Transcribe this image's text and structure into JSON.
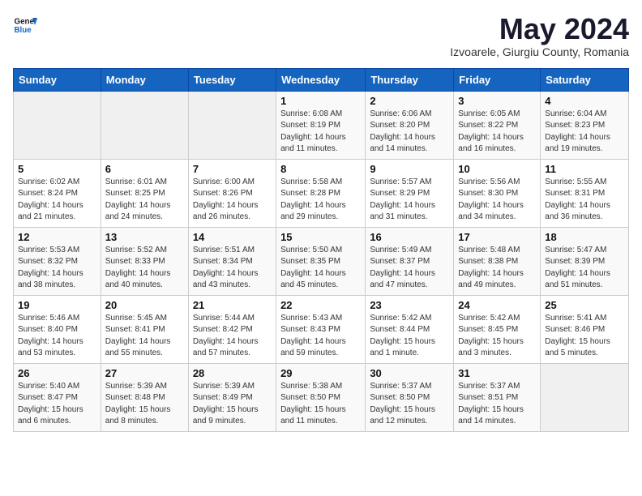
{
  "header": {
    "logo_general": "General",
    "logo_blue": "Blue",
    "month_title": "May 2024",
    "location": "Izvoarele, Giurgiu County, Romania"
  },
  "weekdays": [
    "Sunday",
    "Monday",
    "Tuesday",
    "Wednesday",
    "Thursday",
    "Friday",
    "Saturday"
  ],
  "weeks": [
    [
      {
        "day": "",
        "info": ""
      },
      {
        "day": "",
        "info": ""
      },
      {
        "day": "",
        "info": ""
      },
      {
        "day": "1",
        "info": "Sunrise: 6:08 AM\nSunset: 8:19 PM\nDaylight: 14 hours\nand 11 minutes."
      },
      {
        "day": "2",
        "info": "Sunrise: 6:06 AM\nSunset: 8:20 PM\nDaylight: 14 hours\nand 14 minutes."
      },
      {
        "day": "3",
        "info": "Sunrise: 6:05 AM\nSunset: 8:22 PM\nDaylight: 14 hours\nand 16 minutes."
      },
      {
        "day": "4",
        "info": "Sunrise: 6:04 AM\nSunset: 8:23 PM\nDaylight: 14 hours\nand 19 minutes."
      }
    ],
    [
      {
        "day": "5",
        "info": "Sunrise: 6:02 AM\nSunset: 8:24 PM\nDaylight: 14 hours\nand 21 minutes."
      },
      {
        "day": "6",
        "info": "Sunrise: 6:01 AM\nSunset: 8:25 PM\nDaylight: 14 hours\nand 24 minutes."
      },
      {
        "day": "7",
        "info": "Sunrise: 6:00 AM\nSunset: 8:26 PM\nDaylight: 14 hours\nand 26 minutes."
      },
      {
        "day": "8",
        "info": "Sunrise: 5:58 AM\nSunset: 8:28 PM\nDaylight: 14 hours\nand 29 minutes."
      },
      {
        "day": "9",
        "info": "Sunrise: 5:57 AM\nSunset: 8:29 PM\nDaylight: 14 hours\nand 31 minutes."
      },
      {
        "day": "10",
        "info": "Sunrise: 5:56 AM\nSunset: 8:30 PM\nDaylight: 14 hours\nand 34 minutes."
      },
      {
        "day": "11",
        "info": "Sunrise: 5:55 AM\nSunset: 8:31 PM\nDaylight: 14 hours\nand 36 minutes."
      }
    ],
    [
      {
        "day": "12",
        "info": "Sunrise: 5:53 AM\nSunset: 8:32 PM\nDaylight: 14 hours\nand 38 minutes."
      },
      {
        "day": "13",
        "info": "Sunrise: 5:52 AM\nSunset: 8:33 PM\nDaylight: 14 hours\nand 40 minutes."
      },
      {
        "day": "14",
        "info": "Sunrise: 5:51 AM\nSunset: 8:34 PM\nDaylight: 14 hours\nand 43 minutes."
      },
      {
        "day": "15",
        "info": "Sunrise: 5:50 AM\nSunset: 8:35 PM\nDaylight: 14 hours\nand 45 minutes."
      },
      {
        "day": "16",
        "info": "Sunrise: 5:49 AM\nSunset: 8:37 PM\nDaylight: 14 hours\nand 47 minutes."
      },
      {
        "day": "17",
        "info": "Sunrise: 5:48 AM\nSunset: 8:38 PM\nDaylight: 14 hours\nand 49 minutes."
      },
      {
        "day": "18",
        "info": "Sunrise: 5:47 AM\nSunset: 8:39 PM\nDaylight: 14 hours\nand 51 minutes."
      }
    ],
    [
      {
        "day": "19",
        "info": "Sunrise: 5:46 AM\nSunset: 8:40 PM\nDaylight: 14 hours\nand 53 minutes."
      },
      {
        "day": "20",
        "info": "Sunrise: 5:45 AM\nSunset: 8:41 PM\nDaylight: 14 hours\nand 55 minutes."
      },
      {
        "day": "21",
        "info": "Sunrise: 5:44 AM\nSunset: 8:42 PM\nDaylight: 14 hours\nand 57 minutes."
      },
      {
        "day": "22",
        "info": "Sunrise: 5:43 AM\nSunset: 8:43 PM\nDaylight: 14 hours\nand 59 minutes."
      },
      {
        "day": "23",
        "info": "Sunrise: 5:42 AM\nSunset: 8:44 PM\nDaylight: 15 hours\nand 1 minute."
      },
      {
        "day": "24",
        "info": "Sunrise: 5:42 AM\nSunset: 8:45 PM\nDaylight: 15 hours\nand 3 minutes."
      },
      {
        "day": "25",
        "info": "Sunrise: 5:41 AM\nSunset: 8:46 PM\nDaylight: 15 hours\nand 5 minutes."
      }
    ],
    [
      {
        "day": "26",
        "info": "Sunrise: 5:40 AM\nSunset: 8:47 PM\nDaylight: 15 hours\nand 6 minutes."
      },
      {
        "day": "27",
        "info": "Sunrise: 5:39 AM\nSunset: 8:48 PM\nDaylight: 15 hours\nand 8 minutes."
      },
      {
        "day": "28",
        "info": "Sunrise: 5:39 AM\nSunset: 8:49 PM\nDaylight: 15 hours\nand 9 minutes."
      },
      {
        "day": "29",
        "info": "Sunrise: 5:38 AM\nSunset: 8:50 PM\nDaylight: 15 hours\nand 11 minutes."
      },
      {
        "day": "30",
        "info": "Sunrise: 5:37 AM\nSunset: 8:50 PM\nDaylight: 15 hours\nand 12 minutes."
      },
      {
        "day": "31",
        "info": "Sunrise: 5:37 AM\nSunset: 8:51 PM\nDaylight: 15 hours\nand 14 minutes."
      },
      {
        "day": "",
        "info": ""
      }
    ]
  ]
}
